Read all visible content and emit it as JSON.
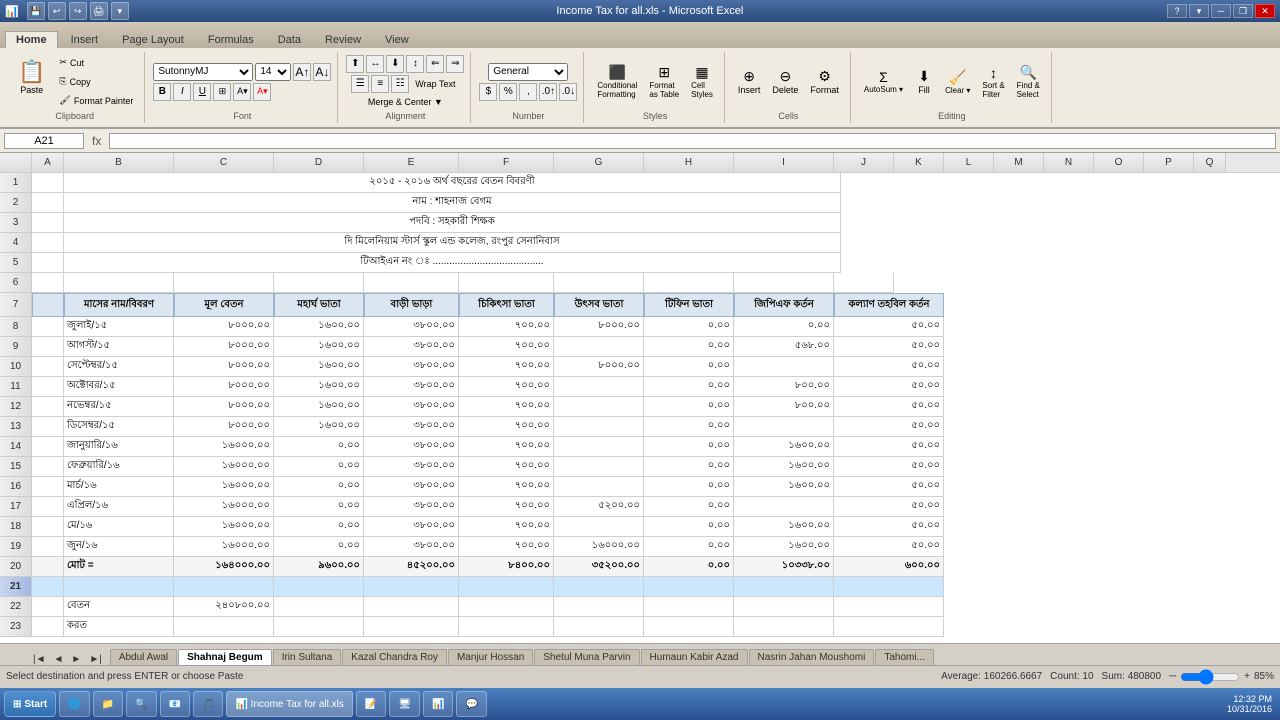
{
  "titlebar": {
    "title": "Income Tax for all.xls - Microsoft Excel",
    "app_icon": "📊",
    "min_label": "─",
    "max_label": "□",
    "close_label": "✕",
    "restore_label": "❐"
  },
  "quick_access": {
    "save_label": "💾",
    "undo_label": "↩",
    "redo_label": "↪",
    "print_label": "🖨"
  },
  "ribbon": {
    "tabs": [
      "Home",
      "Insert",
      "Page Layout",
      "Formulas",
      "Data",
      "Review",
      "View"
    ],
    "active_tab": "Home"
  },
  "clipboard_group": {
    "label": "Clipboard",
    "paste_label": "Paste",
    "cut_label": "Cut",
    "copy_label": "Copy",
    "format_painter_label": "Format Painter"
  },
  "font_group": {
    "label": "Font",
    "font_name": "SutonnyMJ",
    "font_size": "14",
    "bold_label": "B",
    "italic_label": "I",
    "underline_label": "U"
  },
  "alignment_group": {
    "label": "Alignment",
    "wrap_text_label": "Wrap Text",
    "merge_center_label": "Merge & Center ▼"
  },
  "number_group": {
    "label": "Number",
    "format": "General"
  },
  "styles_group": {
    "label": "Styles",
    "conditional_label": "Conditional Formatting",
    "table_label": "Format as Table",
    "cell_styles_label": "Cell Styles"
  },
  "cells_group": {
    "label": "Cells",
    "insert_label": "Insert",
    "delete_label": "Delete",
    "format_label": "Format"
  },
  "editing_group": {
    "label": "Editing",
    "autosum_label": "AutoSum",
    "fill_label": "Fill",
    "clear_label": "Clear",
    "sort_label": "Sort & Filter",
    "find_label": "Find & Select"
  },
  "formula_bar": {
    "cell_ref": "A21",
    "formula": ""
  },
  "columns": [
    "",
    "A",
    "B",
    "C",
    "D",
    "E",
    "F",
    "G",
    "H",
    "I",
    "J",
    "K",
    "L",
    "M",
    "N",
    "O",
    "P",
    "Q"
  ],
  "rows": [
    {
      "num": "1",
      "cells": [
        "",
        "",
        "",
        "",
        "",
        "",
        "",
        "",
        "",
        ""
      ]
    },
    {
      "num": "2",
      "cells": [
        "",
        "",
        "",
        "",
        "",
        "",
        "",
        "",
        "",
        ""
      ]
    },
    {
      "num": "3",
      "cells": [
        "",
        "",
        "",
        "",
        "",
        "",
        "",
        "",
        "",
        ""
      ]
    },
    {
      "num": "4",
      "cells": [
        "",
        "",
        "",
        "",
        "",
        "",
        "",
        "",
        "",
        ""
      ]
    },
    {
      "num": "5",
      "cells": [
        "",
        "",
        "",
        "",
        "",
        "",
        "",
        "",
        "",
        ""
      ]
    },
    {
      "num": "6",
      "cells": [
        "",
        "",
        "",
        "",
        "",
        "",
        "",
        "",
        "",
        ""
      ]
    },
    {
      "num": "7",
      "cells": [
        "মাসের নাম/বিবরণ",
        "মূল বেতন",
        "মহার্ঘ ভাতা",
        "বাড়ী ভাড়া",
        "চিকিৎসা ভাতা",
        "উৎসব ভাতা",
        "টিফিন ভাতা",
        "জিপিএফ কর্তন",
        "কল্যাণ তহবিল কর্তন",
        ""
      ]
    },
    {
      "num": "8",
      "cells": [
        "জুলাই/১৫",
        "৮০০০.০০",
        "১৬০০.০০",
        "৩৮০০.০০",
        "৭০০.০০",
        "৮০০০.০০",
        "০.০০",
        "০.০০",
        "৫০.০০",
        ""
      ]
    },
    {
      "num": "9",
      "cells": [
        "আগস্ট/১৫",
        "৮০০০.০০",
        "১৬০০.০০",
        "৩৮০০.০০",
        "৭০০.০০",
        "",
        "০.০০",
        "৫৬৮.০০",
        "৫০.০০",
        ""
      ]
    },
    {
      "num": "10",
      "cells": [
        "সেপ্টেম্বর/১৫",
        "৮০০০.০০",
        "১৬০০.০০",
        "৩৮০০.০০",
        "৭০০.০০",
        "৮০০০.০০",
        "০.০০",
        "",
        "৫০.০০",
        ""
      ]
    },
    {
      "num": "11",
      "cells": [
        "অক্টোবর/১৫",
        "৮০০০.০০",
        "১৬০০.০০",
        "৩৮০০.০০",
        "৭০০.০০",
        "",
        "০.০০",
        "৮০০.০০",
        "৫০.০০",
        ""
      ]
    },
    {
      "num": "12",
      "cells": [
        "নভেম্বর/১৫",
        "৮০০০.০০",
        "১৬০০.০০",
        "৩৮০০.০০",
        "৭০০.০০",
        "",
        "০.০০",
        "৮০০.০০",
        "৫০.০০",
        ""
      ]
    },
    {
      "num": "13",
      "cells": [
        "ডিসেম্বর/১৫",
        "৮০০০.০০",
        "১৬০০.০০",
        "৩৮০০.০০",
        "৭০০.০০",
        "",
        "০.০০",
        "",
        "৫০.০০",
        ""
      ]
    },
    {
      "num": "14",
      "cells": [
        "জানুয়ারি/১৬",
        "১৬০০০.০০",
        "০.০০",
        "৩৮০০.০০",
        "৭০০.০০",
        "",
        "০.০০",
        "১৬০০.০০",
        "৫০.০০",
        ""
      ]
    },
    {
      "num": "15",
      "cells": [
        "ফেব্রুয়ারি/১৬",
        "১৬০০০.০০",
        "০.০০",
        "৩৮০০.০০",
        "৭০০.০০",
        "",
        "০.০০",
        "১৬০০.০০",
        "৫০.০০",
        ""
      ]
    },
    {
      "num": "16",
      "cells": [
        "মার্চ/১৬",
        "১৬০০০.০০",
        "০.০০",
        "৩৮০০.০০",
        "৭০০.০০",
        "",
        "০.০০",
        "১৬০০.০০",
        "৫০.০০",
        ""
      ]
    },
    {
      "num": "17",
      "cells": [
        "এপ্রিল/১৬",
        "১৬০০০.০০",
        "০.০০",
        "৩৮০০.০০",
        "৭০০.০০",
        "৫২০০.০০",
        "০.০০",
        "",
        "৫০.০০",
        ""
      ]
    },
    {
      "num": "18",
      "cells": [
        "মে/১৬",
        "১৬০০০.০০",
        "০.০০",
        "৩৮০০.০০",
        "৭০০.০০",
        "",
        "০.০০",
        "১৬০০.০০",
        "৫০.০০",
        ""
      ]
    },
    {
      "num": "19",
      "cells": [
        "জুন/১৬",
        "১৬০০০.০০",
        "০.০০",
        "৩৮০০.০০",
        "৭০০.০০",
        "১৬০০০.০০",
        "০.০০",
        "১৬০০.০০",
        "৫০.০০",
        ""
      ]
    },
    {
      "num": "20",
      "cells": [
        "মোট =",
        "১৬৪০০০.০০",
        "৯৬০০.০০",
        "৪৫২০০.০০",
        "৮৪০০.০০",
        "৩৫২০০.০০",
        "০.০০",
        "১০৩৩৮.০০",
        "৬০০.০০",
        ""
      ]
    },
    {
      "num": "21",
      "cells": [
        "",
        "",
        "",
        "",
        "",
        "",
        "",
        "",
        "",
        ""
      ]
    },
    {
      "num": "22",
      "cells": [
        "বেতন",
        "",
        "২৪০৮০০.০০",
        "",
        "",
        "",
        "",
        "",
        "",
        ""
      ]
    },
    {
      "num": "23",
      "cells": [
        "করত",
        "",
        "",
        "",
        "",
        "",
        "",
        "",
        "",
        ""
      ]
    }
  ],
  "sheet_tabs": [
    "Abdul Awal",
    "Shahnaj Begum",
    "Irin Sultana",
    "Kazal Chandra Roy",
    "Manjur Hossan",
    "Shetul Muna Parvin",
    "Humaun Kabir Azad",
    "Nasrin Jahan Moushomi",
    "Tahomi..."
  ],
  "active_sheet": "Shahnaj Begum",
  "statusbar": {
    "status": "Select destination and press ENTER or choose Paste",
    "average_label": "Average: 160266.6667",
    "count_label": "Count: 10",
    "sum_label": "Sum: 480800",
    "zoom_level": "85%"
  },
  "header_row": {
    "title1": "২০১৫ - ২০১৬ অর্থ বছরের বেতন বিবরণী",
    "title2": "নাম : শাহনাজ বেগম",
    "title3": "পদবি : সহকারী শিক্ষক",
    "title4": "দি মিলেনিয়াম স্টার্স স্কুল এন্ড কলেজ, রংপুর সেনানিবাস",
    "title5": "টিআইএন নং ঃ ........................................"
  },
  "taskbar": {
    "start_label": "Start",
    "apps": [
      "🌐",
      "📁",
      "🔍",
      "📧",
      "🎵",
      "📊",
      "📝",
      "🖥",
      "📊",
      "💬"
    ],
    "time": "12:32 PM",
    "date": "10/31/2016"
  }
}
